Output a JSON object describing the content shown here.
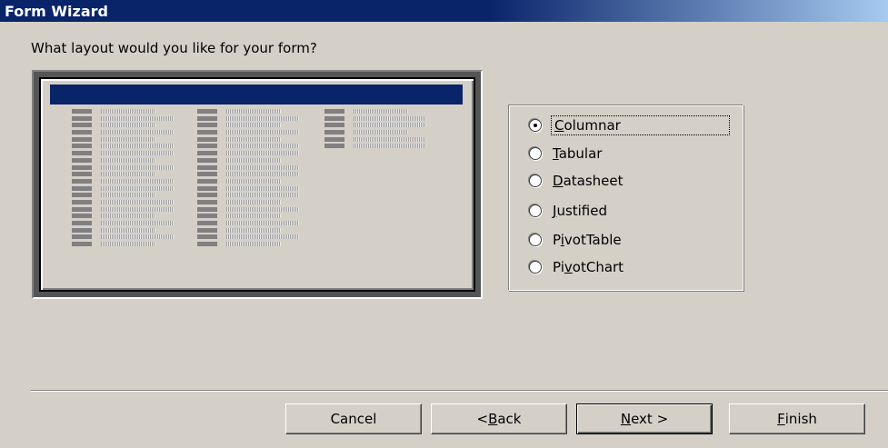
{
  "window": {
    "title": "Form Wizard"
  },
  "prompt": "What layout would you like for your form?",
  "layout_options": [
    {
      "label": "Columnar",
      "mnemonic": "C",
      "rest": "olumnar",
      "selected": true
    },
    {
      "label": "Tabular",
      "mnemonic": "T",
      "rest": "abular",
      "selected": false
    },
    {
      "label": "Datasheet",
      "mnemonic": "D",
      "rest": "atasheet",
      "selected": false
    },
    {
      "label": "Justified",
      "mnemonic": "J",
      "rest": "ustified",
      "selected": false
    },
    {
      "label": "PivotTable",
      "prefix": "P",
      "mnemonic": "i",
      "rest": "votTable",
      "selected": false
    },
    {
      "label": "PivotChart",
      "prefix": "Pi",
      "mnemonic": "v",
      "rest": "otChart",
      "selected": false
    }
  ],
  "buttons": {
    "cancel": "Cancel",
    "back_prefix": "< ",
    "back_mnemonic": "B",
    "back_rest": "ack",
    "next_mnemonic": "N",
    "next_rest": "ext >",
    "finish_mnemonic": "F",
    "finish_rest": "inish"
  },
  "colors": {
    "titlebar": "#0a246a",
    "face": "#d4d0c8"
  }
}
